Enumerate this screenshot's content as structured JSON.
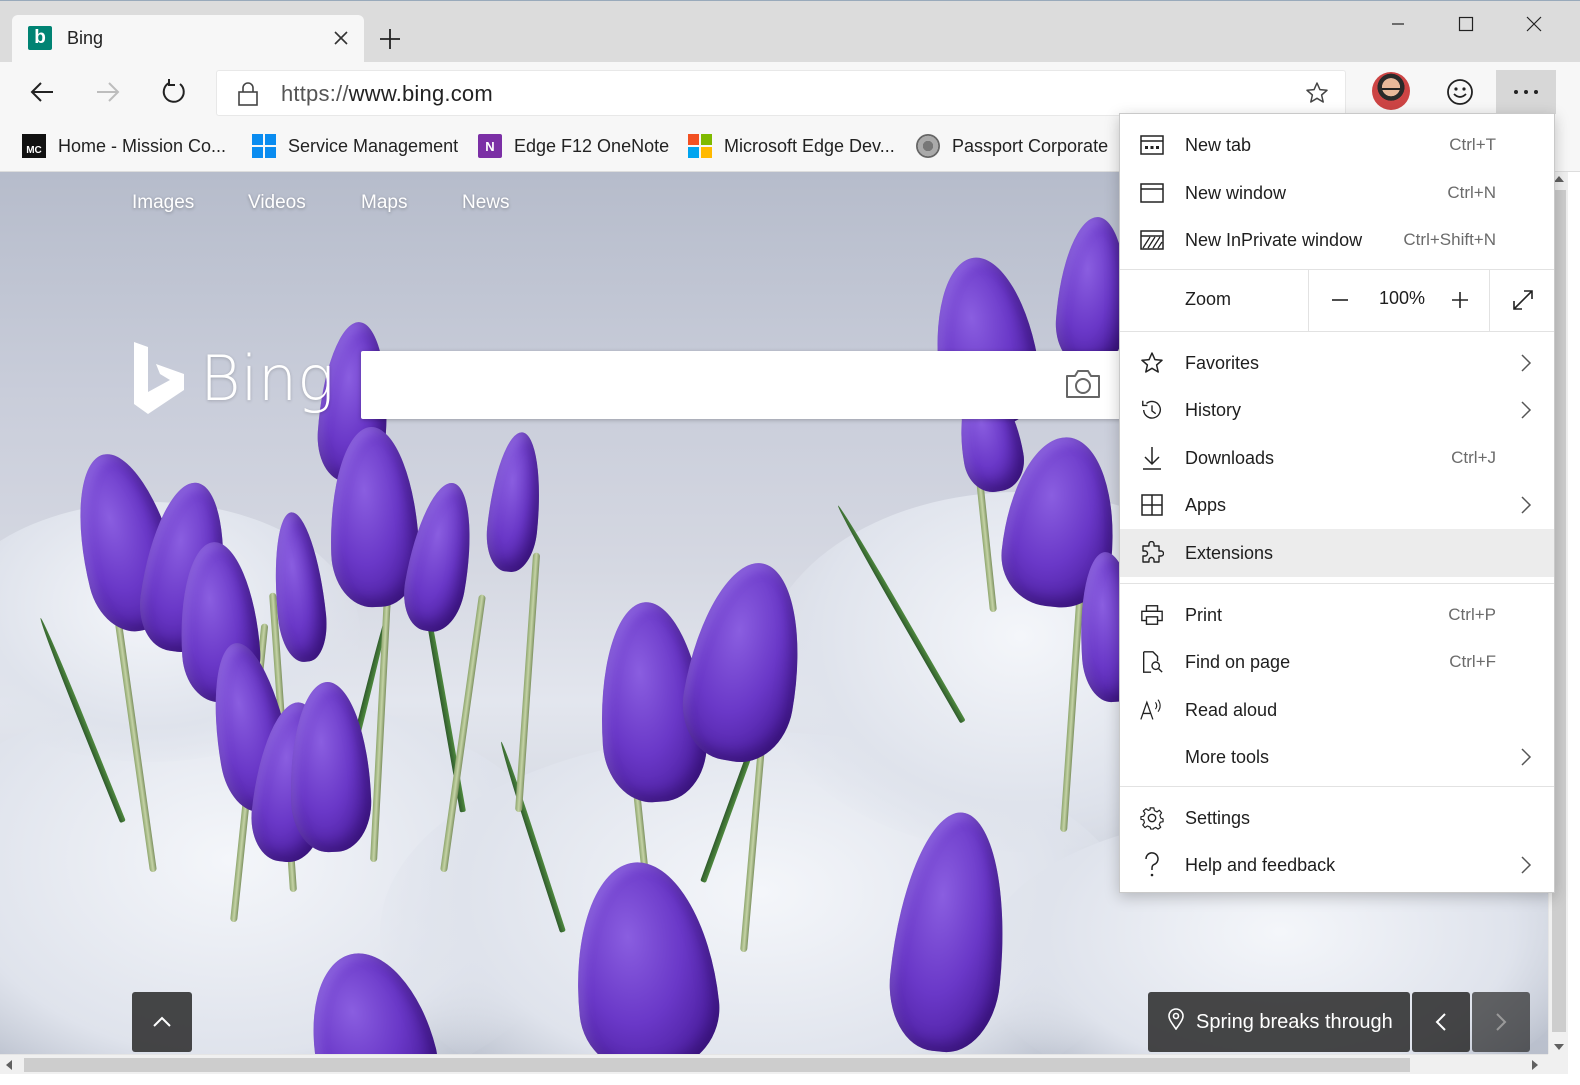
{
  "tab": {
    "title": "Bing",
    "favicon": "bing-b"
  },
  "window_controls": {
    "minimize": "minimize-icon",
    "maximize": "maximize-icon",
    "close": "close-icon"
  },
  "address": {
    "scheme": "https://",
    "host": "www.bing.com"
  },
  "favorites_bar": [
    {
      "label": "Home - Mission Co...",
      "icon": "mission-control-icon"
    },
    {
      "label": "Service Management",
      "icon": "windows-icon"
    },
    {
      "label": "Edge F12 OneNote",
      "icon": "onenote-icon"
    },
    {
      "label": "Microsoft Edge Dev...",
      "icon": "microsoft-icon"
    },
    {
      "label": "Passport Corporate",
      "icon": "passport-icon"
    }
  ],
  "bing": {
    "nav": [
      "Images",
      "Videos",
      "Maps",
      "News"
    ],
    "logo_text": "Bing",
    "caption": "Spring breaks through"
  },
  "menu": {
    "items": [
      {
        "label": "New tab",
        "shortcut": "Ctrl+T",
        "icon": "new-tab-icon"
      },
      {
        "label": "New window",
        "shortcut": "Ctrl+N",
        "icon": "new-window-icon"
      },
      {
        "label": "New InPrivate window",
        "shortcut": "Ctrl+Shift+N",
        "icon": "inprivate-icon"
      },
      {
        "label": "Favorites",
        "shortcut": "",
        "icon": "star-icon"
      },
      {
        "label": "History",
        "shortcut": "",
        "icon": "history-icon"
      },
      {
        "label": "Downloads",
        "shortcut": "Ctrl+J",
        "icon": "download-icon"
      },
      {
        "label": "Apps",
        "shortcut": "",
        "icon": "apps-icon"
      },
      {
        "label": "Extensions",
        "shortcut": "",
        "icon": "puzzle-icon"
      },
      {
        "label": "Print",
        "shortcut": "Ctrl+P",
        "icon": "print-icon"
      },
      {
        "label": "Find on page",
        "shortcut": "Ctrl+F",
        "icon": "find-icon"
      },
      {
        "label": "Read aloud",
        "shortcut": "",
        "icon": "read-aloud-icon"
      },
      {
        "label": "More tools",
        "shortcut": "",
        "icon": ""
      },
      {
        "label": "Settings",
        "shortcut": "",
        "icon": "gear-icon"
      },
      {
        "label": "Help and feedback",
        "shortcut": "",
        "icon": "help-icon"
      }
    ],
    "zoom": {
      "label": "Zoom",
      "value": "100%"
    }
  },
  "colors": {
    "accent": "#008373",
    "crocus": "#6a38c8",
    "menu_hover": "#ececec"
  }
}
